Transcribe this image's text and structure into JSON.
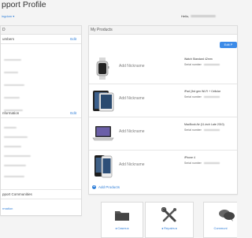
{
  "header": {
    "title": "pport Profile",
    "breadcrumb": "ingdom ▾",
    "greeting": "Hello,"
  },
  "left_panel": {
    "section_top_title": "D",
    "numbers_label": "umbers",
    "numbers_edit": "Edit",
    "information_label": "nformation",
    "information_edit": "Edit",
    "communities_label": "pport Communities",
    "communities_link": "rmation"
  },
  "products": {
    "title": "My Products",
    "edit_button": "Edit P",
    "add_label": "Add Products",
    "serial_label": "Serial number",
    "nickname_placeholder": "Add Nickname",
    "devices": [
      {
        "name": "Watch Standard 42mm",
        "icon": "apple-watch-icon"
      },
      {
        "name": "iPad (3rd gen Wi-Fi + Cellular",
        "icon": "ipad-icon"
      },
      {
        "name": "MacBook Air (11-inch Late 2010)",
        "icon": "macbook-icon"
      },
      {
        "name": "iPhone 4",
        "icon": "iphone-icon"
      }
    ]
  },
  "tiles": [
    {
      "label": "◂ Cases ▸",
      "icon": "folder-icon"
    },
    {
      "label": "◂ Repairs ▸",
      "icon": "tools-icon"
    },
    {
      "label": "Communi",
      "icon": "speech-bubbles-icon"
    }
  ]
}
